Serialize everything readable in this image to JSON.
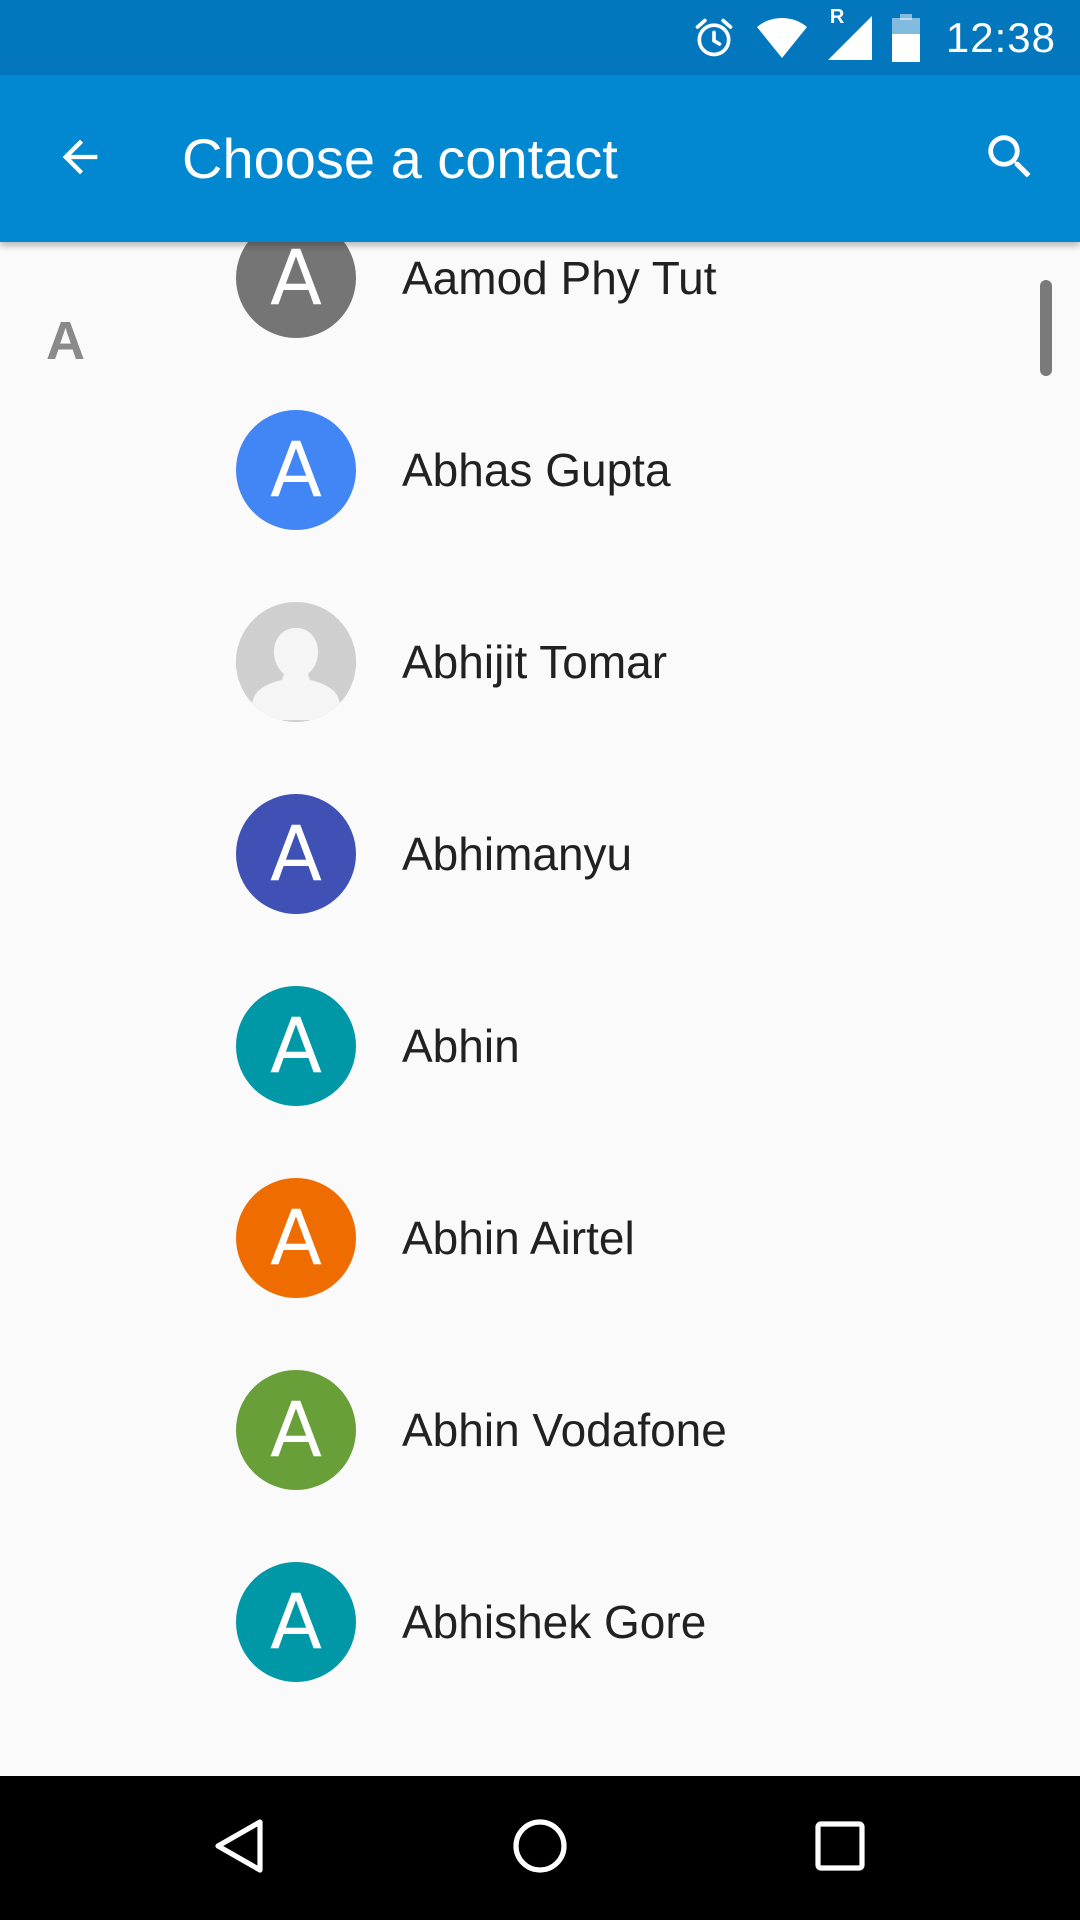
{
  "status_bar": {
    "time": "12:38",
    "roaming_indicator": "R",
    "icons": [
      "alarm-icon",
      "wifi-icon",
      "cell-signal-icon",
      "battery-icon"
    ]
  },
  "app_bar": {
    "title": "Choose a contact",
    "back_icon": "arrow-back-icon",
    "search_icon": "search-icon",
    "background": "#0288D1",
    "status_background": "#0277BD"
  },
  "section": {
    "letter": "A"
  },
  "contacts": [
    {
      "name": "Aamod Phy Tut",
      "initial": "A",
      "color": "#757575",
      "photo": false
    },
    {
      "name": "Abhas Gupta",
      "initial": "A",
      "color": "#4285F4",
      "photo": false
    },
    {
      "name": "Abhijit Tomar",
      "initial": "",
      "color": "#CFCFCF",
      "photo": true
    },
    {
      "name": "Abhimanyu",
      "initial": "A",
      "color": "#3F51B5",
      "photo": false
    },
    {
      "name": "Abhin",
      "initial": "A",
      "color": "#0097A7",
      "photo": false
    },
    {
      "name": "Abhin Airtel",
      "initial": "A",
      "color": "#EF6C00",
      "photo": false
    },
    {
      "name": "Abhin Vodafone",
      "initial": "A",
      "color": "#689F38",
      "photo": false
    },
    {
      "name": "Abhishek Gore",
      "initial": "A",
      "color": "#0097A7",
      "photo": false
    }
  ],
  "nav_bar": {
    "back": "nav-back-icon",
    "home": "nav-home-icon",
    "recents": "nav-recents-icon"
  }
}
